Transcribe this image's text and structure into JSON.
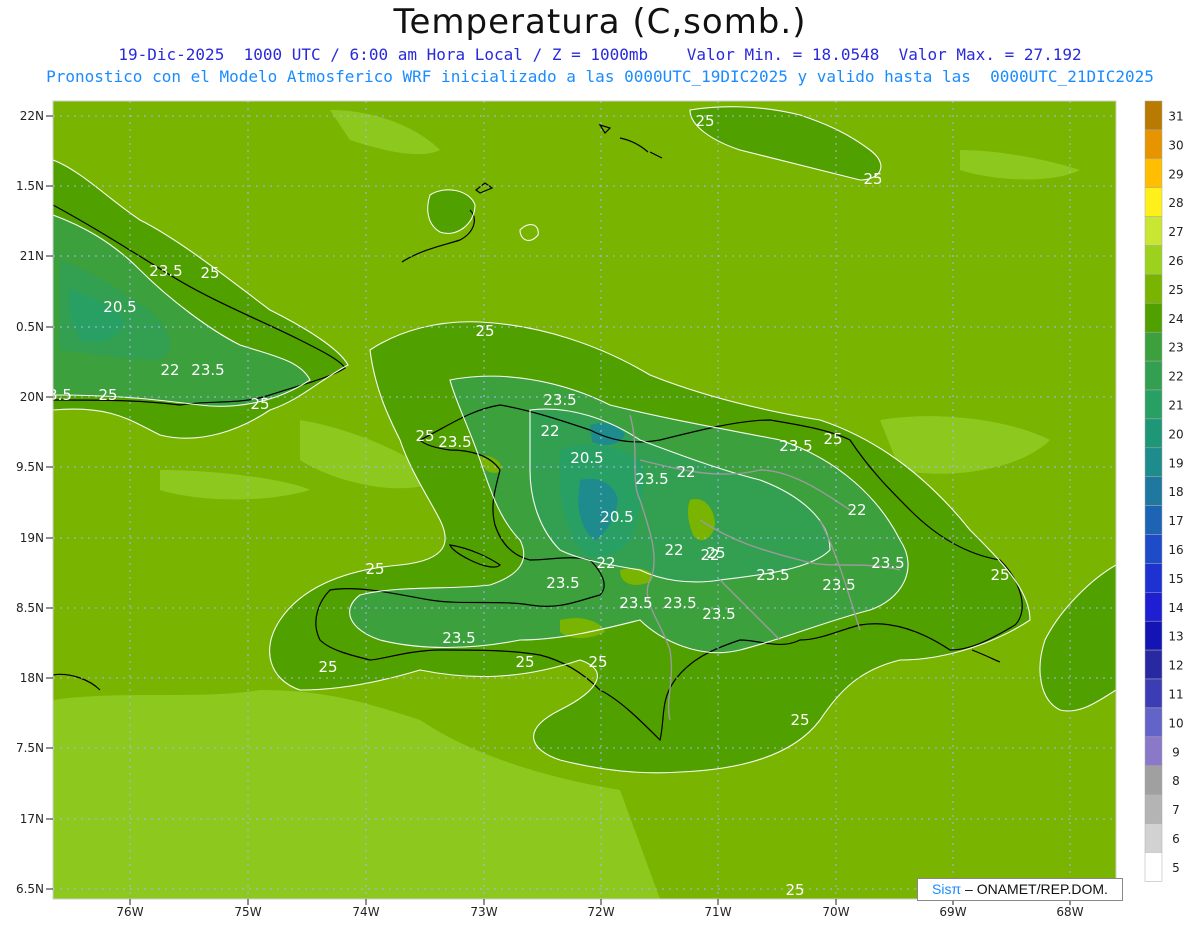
{
  "header": {
    "title": "Temperatura (C,somb.)",
    "line1": "19-Dic-2025  1000 UTC / 6:00 am Hora Local / Z = 1000mb    Valor Min. = 18.0548  Valor Max. = 27.192",
    "line2": "Pronostico con el Modelo Atmosferico WRF inicializado a las 0000UTC_19DIC2025 y valido hasta las  0000UTC_21DIC2025"
  },
  "axes": {
    "lat_labels": [
      "22N",
      "1.5N",
      "21N",
      "0.5N",
      "20N",
      "9.5N",
      "19N",
      "8.5N",
      "18N",
      "7.5N",
      "17N",
      "6.5N"
    ],
    "lon_labels": [
      "76W",
      "75W",
      "74W",
      "73W",
      "72W",
      "71W",
      "70W",
      "69W",
      "68W"
    ]
  },
  "colorbar": {
    "labels": [
      "31",
      "30",
      "29",
      "28",
      "27",
      "26",
      "25",
      "24",
      "23",
      "22",
      "21",
      "20",
      "19",
      "18",
      "17",
      "16",
      "15",
      "14",
      "13",
      "12",
      "11",
      "10",
      "9",
      "8",
      "7",
      "6",
      "5"
    ],
    "colors": [
      "#b87a00",
      "#e69500",
      "#ffbf00",
      "#ffef1a",
      "#c8e632",
      "#9cd21e",
      "#78b400",
      "#50a000",
      "#3ca03c",
      "#32a050",
      "#28a064",
      "#1e9678",
      "#1e8c8c",
      "#1e78a0",
      "#1e64b4",
      "#1e4bc8",
      "#1e32d2",
      "#1e1ed2",
      "#1414b4",
      "#2828a0",
      "#3c3cb4",
      "#6464c8",
      "#8c78c8",
      "#a0a0a0",
      "#b4b4b4",
      "#d2d2d2",
      "#ffffff"
    ]
  },
  "contour_labels": [
    {
      "text": "25"
    },
    {
      "text": "25"
    },
    {
      "text": "23.5"
    },
    {
      "text": "25"
    },
    {
      "text": "20.5"
    },
    {
      "text": "22"
    },
    {
      "text": "23.5"
    },
    {
      "text": "3.5"
    },
    {
      "text": "25"
    },
    {
      "text": "25"
    },
    {
      "text": "25"
    },
    {
      "text": "23.5"
    },
    {
      "text": "25"
    },
    {
      "text": "23.5"
    },
    {
      "text": "22"
    },
    {
      "text": "20.5"
    },
    {
      "text": "23.5"
    },
    {
      "text": "22"
    },
    {
      "text": "20.5"
    },
    {
      "text": "22"
    },
    {
      "text": "23.5"
    },
    {
      "text": "25"
    },
    {
      "text": "22"
    },
    {
      "text": "23.5"
    },
    {
      "text": "23.5"
    },
    {
      "text": "25"
    },
    {
      "text": "23.5"
    },
    {
      "text": "23.5"
    },
    {
      "text": "22"
    },
    {
      "text": "23.5"
    },
    {
      "text": "23.5"
    },
    {
      "text": "23.5"
    },
    {
      "text": "23.5"
    },
    {
      "text": "25"
    },
    {
      "text": "25"
    },
    {
      "text": "25"
    },
    {
      "text": "25"
    },
    {
      "text": "25"
    },
    {
      "text": "25"
    },
    {
      "text": "25"
    },
    {
      "text": "22"
    }
  ],
  "credit": {
    "sis": "Sisπ",
    "rest": " – ONAMET/REP.DOM."
  }
}
